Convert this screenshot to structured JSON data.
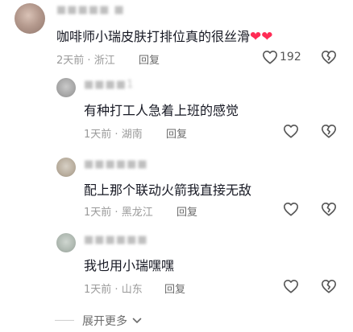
{
  "comments": [
    {
      "username": "■■■■■ ■",
      "text": "咖啡师小瑞皮肤打排位真的很丝滑",
      "emoji": "❤❤",
      "time": "2天前",
      "location": "浙江",
      "reply": "回复",
      "likes": "192"
    }
  ],
  "replies": [
    {
      "username": "■■■■1",
      "text": "有种打工人急着上班的感觉",
      "time": "1天前",
      "location": "湖南",
      "reply": "回复"
    },
    {
      "username": "■■■■■■",
      "text": "配上那个联动火箭我直接无敌",
      "time": "1天前",
      "location": "黑龙江",
      "reply": "回复"
    },
    {
      "username": "■■■■■■",
      "text": "我也用小瑞嘿嘿",
      "time": "1天前",
      "location": "山东",
      "reply": "回复"
    }
  ],
  "expand": {
    "label": "展开更多",
    "icon": "chevron-down-icon"
  },
  "icons": {
    "like": "heart-outline-icon",
    "dislike": "broken-heart-icon"
  }
}
